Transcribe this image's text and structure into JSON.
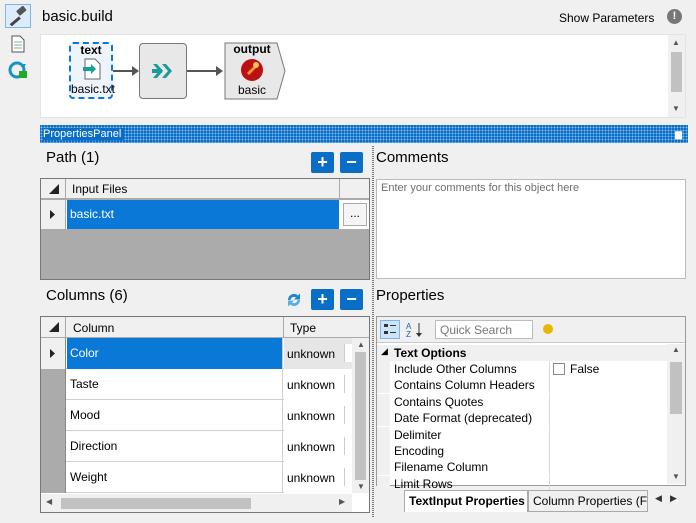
{
  "header": {
    "title": "basic.build",
    "show_parameters": "Show Parameters",
    "info_glyph": "!"
  },
  "flow": {
    "nodes": [
      {
        "top_label": "text",
        "bottom_label": "basic.txt"
      },
      {
        "top_label": "",
        "bottom_label": ""
      },
      {
        "top_label": "output",
        "bottom_label": "basic"
      }
    ]
  },
  "panel": {
    "title": "PropertiesPanel",
    "pin_glyph": "▆"
  },
  "path": {
    "title": "Path (1)",
    "column_header": "Input Files",
    "rows": [
      {
        "value": "basic.txt",
        "ellipsis": "..."
      }
    ]
  },
  "columns": {
    "title": "Columns (6)",
    "headers": [
      "Column",
      "Type"
    ],
    "rows": [
      {
        "column": "Color",
        "type": "unknown"
      },
      {
        "column": "Taste",
        "type": "unknown"
      },
      {
        "column": "Mood",
        "type": "unknown"
      },
      {
        "column": "Direction",
        "type": "unknown"
      },
      {
        "column": "Weight",
        "type": "unknown"
      }
    ]
  },
  "comments": {
    "title": "Comments",
    "placeholder": "Enter your comments for this object here"
  },
  "properties": {
    "title": "Properties",
    "search_placeholder": "Quick Search",
    "category": "Text Options",
    "rows": [
      {
        "label": "Include Other Columns",
        "value": "False"
      },
      {
        "label": "Contains Column Headers",
        "value": ""
      },
      {
        "label": "Contains Quotes",
        "value": ""
      },
      {
        "label": "Date Format (deprecated)",
        "value": ""
      },
      {
        "label": "Delimiter",
        "value": ""
      },
      {
        "label": "Encoding",
        "value": ""
      },
      {
        "label": "Filename Column",
        "value": ""
      },
      {
        "label": "Limit Rows",
        "value": ""
      }
    ],
    "tabs": [
      "TextInput Properties",
      "Column Properties (F"
    ]
  },
  "colors": {
    "accent": "#0a6ec7",
    "selection": "#0a78d7"
  }
}
